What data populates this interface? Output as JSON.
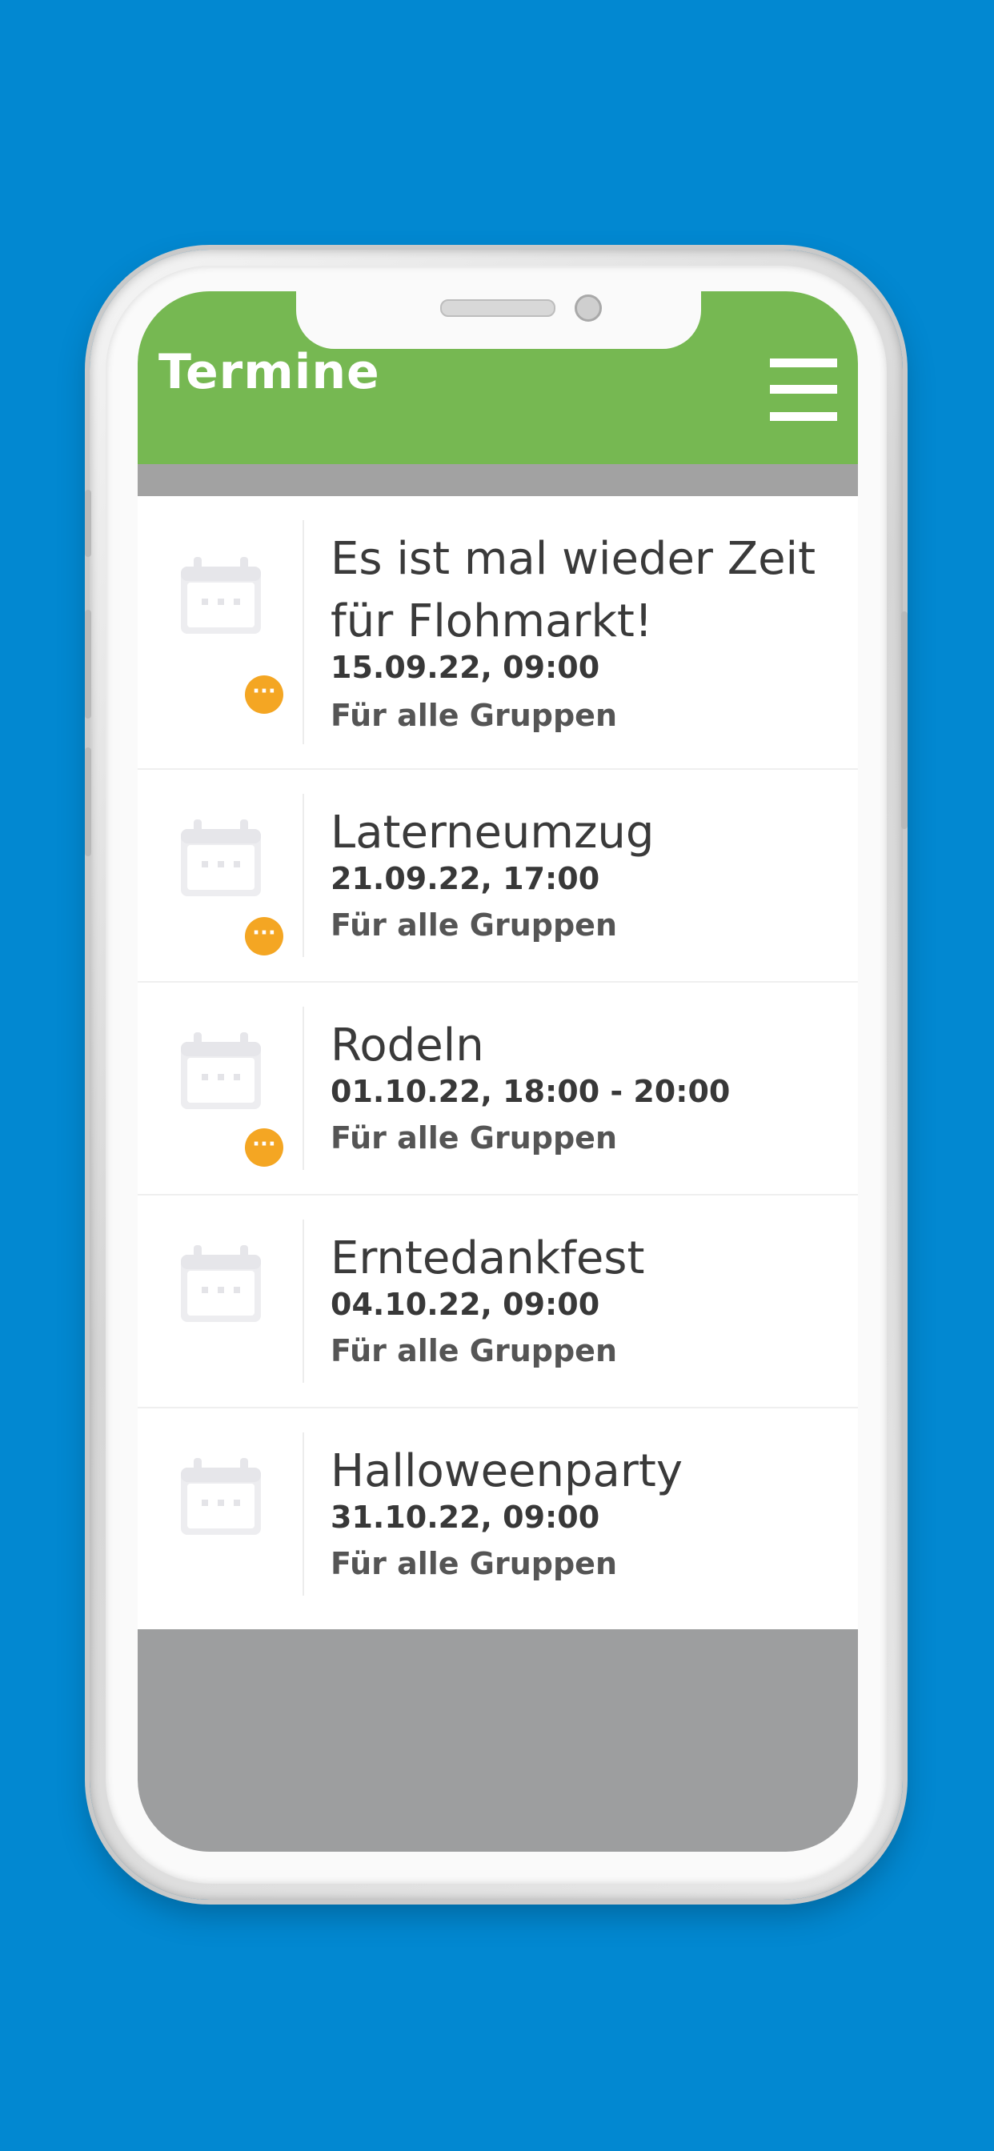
{
  "header": {
    "title": "Termine"
  },
  "events": [
    {
      "title": "Es ist mal wieder Zeit für Flohmarkt!",
      "date": "15.09.22, 09:00",
      "group": "Für alle Gruppen",
      "badge": "···"
    },
    {
      "title": "Laterneumzug",
      "date": "21.09.22, 17:00",
      "group": "Für alle Gruppen",
      "badge": "···"
    },
    {
      "title": "Rodeln",
      "date": "01.10.22, 18:00 - 20:00",
      "group": "Für alle Gruppen",
      "badge": "···"
    },
    {
      "title": "Erntedankfest",
      "date": "04.10.22, 09:00",
      "group": "Für alle Gruppen"
    },
    {
      "title": "Halloweenparty",
      "date": "31.10.22, 09:00",
      "group": "Für alle Gruppen"
    }
  ],
  "icons": {
    "event": "calendar-icon",
    "menu": "hamburger-menu-icon",
    "badge": "more-dots-icon"
  },
  "colors": {
    "background": "#0288d1",
    "header": "#76b852",
    "badge": "#f4a623",
    "footer": "#9d9e9f"
  }
}
